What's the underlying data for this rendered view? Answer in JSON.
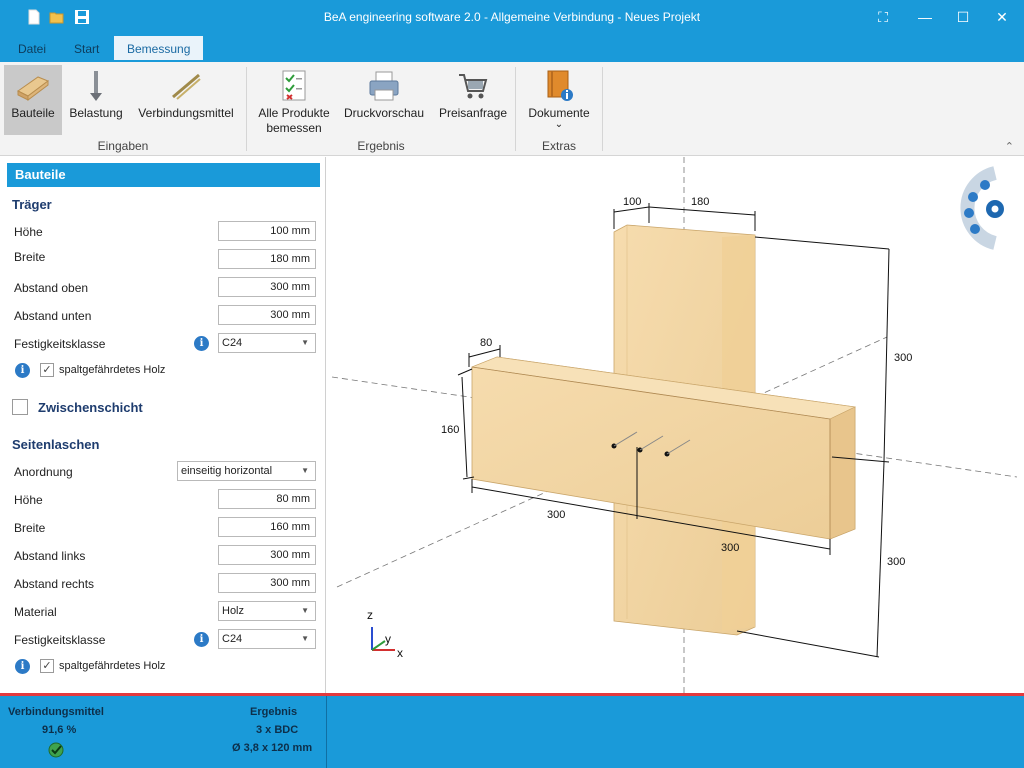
{
  "window": {
    "title": "BeA engineering software 2.0 - Allgemeine Verbindung - Neues Projekt",
    "controls": {
      "snap": "⛶",
      "minimize": "—",
      "maximize": "☐",
      "close": "✕"
    }
  },
  "menu_tabs": [
    {
      "label": "Datei"
    },
    {
      "label": "Start"
    },
    {
      "label": "Bemessung"
    }
  ],
  "ribbon": {
    "groups": [
      {
        "label": "Eingaben"
      },
      {
        "label": "Ergebnis"
      },
      {
        "label": "Extras"
      }
    ],
    "buttons": {
      "bauteile": "Bauteile",
      "belastung": "Belastung",
      "verbindungsmittel": "Verbindungsmittel",
      "alle_line1": "Alle Produkte",
      "alle_line2": "bemessen",
      "druckvorschau": "Druckvorschau",
      "preisanfrage": "Preisanfrage",
      "dokumente": "Dokumente",
      "dokumente_arrow": "⌄"
    },
    "collapse": "⌃"
  },
  "panel": {
    "header": "Bauteile",
    "traeger": {
      "title": "Träger",
      "hoehe_label": "Höhe",
      "hoehe": "100 mm",
      "breite_label": "Breite",
      "breite": "180 mm",
      "abstand_oben_label": "Abstand oben",
      "abstand_oben": "300 mm",
      "abstand_unten_label": "Abstand unten",
      "abstand_unten": "300 mm",
      "festigkeit_label": "Festigkeitsklasse",
      "festigkeit": "C24",
      "spalt_label": "spaltgefährdetes Holz",
      "spalt_checked": "✓"
    },
    "zwischenschicht": {
      "label": "Zwischenschicht"
    },
    "seitenlaschen": {
      "title": "Seitenlaschen",
      "anordnung_label": "Anordnung",
      "anordnung": "einseitig horizontal",
      "hoehe_label": "Höhe",
      "hoehe": "80 mm",
      "breite_label": "Breite",
      "breite": "160 mm",
      "abstand_links_label": "Abstand links",
      "abstand_links": "300 mm",
      "abstand_rechts_label": "Abstand rechts",
      "abstand_rechts": "300 mm",
      "material_label": "Material",
      "material": "Holz",
      "festigkeit_label": "Festigkeitsklasse",
      "festigkeit": "C24",
      "spalt_label": "spaltgefährdetes Holz",
      "spalt_checked": "✓"
    },
    "info_glyph": "i",
    "combo_arrow": "▼"
  },
  "viewport": {
    "dims": {
      "d100": "100",
      "d180": "180",
      "d80": "80",
      "d160": "160",
      "d300_top": "300",
      "d300_bottom_right": "300",
      "d300_horizontal": "300",
      "d300_horizontal2": "300"
    },
    "axes": {
      "z": "z",
      "y": "y",
      "x": "x"
    },
    "colors": {
      "wood": "#f3d7a4",
      "wood_dark": "#e4bf85",
      "axis_x": "#d32f2f",
      "axis_y": "#2e9c3a",
      "axis_z": "#2a4dd0"
    }
  },
  "status": {
    "verbindungsmittel_label": "Verbindungsmittel",
    "verbindungsmittel_value": "91,6 %",
    "ergebnis_label": "Ergebnis",
    "ergebnis_line1": "3 x BDC",
    "ergebnis_line2": "Ø 3,8 x 120 mm"
  }
}
